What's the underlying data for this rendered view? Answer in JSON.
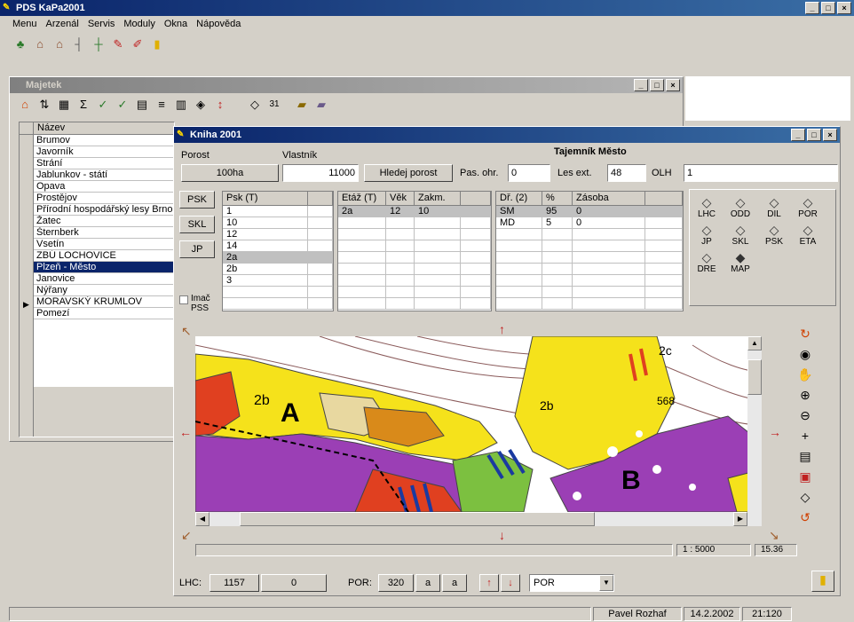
{
  "app": {
    "title": "PDS KaPa2001",
    "icon": "pds-app-icon"
  },
  "menu": [
    "Menu",
    "Arzenál",
    "Servis",
    "Moduly",
    "Okna",
    "Nápověda"
  ],
  "toolbar_icons": [
    "tree-icon",
    "building-icon",
    "buildings-icon",
    "ruler-icon",
    "ruler-add-icon",
    "paint-icon",
    "paint-red-icon",
    "exit-door-icon"
  ],
  "mdi": {
    "title": "Majetek",
    "toolbar_icons": [
      "home-icon",
      "sort-icon",
      "table-icon",
      "sum-icon",
      "check-icon",
      "check2-icon",
      "grid-icon",
      "filter-icon",
      "grid2-icon",
      "map-icon",
      "pin-icon",
      "layers-icon",
      "zoom-icon",
      "books-icon",
      "books2-icon"
    ],
    "zoom_value": "31"
  },
  "left_list": {
    "header": "Název",
    "items": [
      "Brumov",
      "Javorník",
      "Strání",
      "Jablunkov - státí",
      "Opava",
      "Prostějov",
      "Přírodní hospodářský lesy Brno",
      "Žatec",
      "Šternberk",
      "Vsetín",
      "ZBÚ LOCHOVICE",
      "Plzeň - Město",
      "Janovice",
      "Nýřany",
      "MORAVSKÝ KRUMLOV",
      "Pomezí"
    ],
    "selected_index": 11
  },
  "kniha": {
    "title": "Kniha 2001",
    "labels": {
      "porost": "Porost",
      "vlastnik": "Vlastník",
      "tajemnik": "Tajemník Město",
      "pas_ohr": "Pas. ohr.",
      "les_ext": "Les ext.",
      "olh": "OLH"
    },
    "fields": {
      "area": "100ha",
      "value": "11000",
      "pas_ohr": "0",
      "les_ext": "48",
      "olh": "1"
    },
    "hledej_button": "Hledej porost",
    "side_buttons": [
      "PSK",
      "SKL",
      "JP"
    ],
    "checkbox_label": "Imač PSS",
    "grid1": {
      "headers": [
        "Psk (T)",
        ""
      ],
      "rows": [
        [
          "1",
          ""
        ],
        [
          "10",
          ""
        ],
        [
          "12",
          ""
        ],
        [
          "14",
          ""
        ],
        [
          "2a",
          ""
        ],
        [
          "2b",
          ""
        ],
        [
          "3",
          ""
        ]
      ],
      "selected_index": 4
    },
    "grid2": {
      "headers": [
        "Etáž (T)",
        "Věk",
        "Zakm.",
        ""
      ],
      "rows": [
        [
          "2a",
          "12",
          "10",
          ""
        ]
      ],
      "selected_index": 0
    },
    "grid3": {
      "headers": [
        "Dř. (2)",
        "%",
        "Zásoba",
        ""
      ],
      "rows": [
        [
          "SM",
          "95",
          "0",
          ""
        ],
        [
          "MD",
          "5",
          "0",
          ""
        ]
      ],
      "selected_index": 0
    },
    "layers": [
      {
        "label": "LHC",
        "icon": "layer-lhc-icon"
      },
      {
        "label": "ODD",
        "icon": "layer-odd-icon"
      },
      {
        "label": "DIL",
        "icon": "layer-dil-icon"
      },
      {
        "label": "POR",
        "icon": "layer-por-icon"
      },
      {
        "label": "JP",
        "icon": "layer-jp-icon"
      },
      {
        "label": "SKL",
        "icon": "layer-skl-icon"
      },
      {
        "label": "PSK",
        "icon": "layer-psk-icon"
      },
      {
        "label": "ETA",
        "icon": "layer-eta-icon"
      },
      {
        "label": "DRE",
        "icon": "layer-dre-icon"
      },
      {
        "label": "MAP",
        "icon": "layer-map-icon"
      }
    ],
    "map_labels": {
      "a": "A",
      "b": "B",
      "l2b": "2b",
      "l2b2": "2b",
      "l2c": "2c",
      "l568": "568"
    },
    "map_tools": [
      "rotate-icon",
      "globe-icon",
      "pan-icon",
      "zoom-in-icon",
      "zoom-out-icon",
      "crosshair-icon",
      "print-icon",
      "layers-red-icon",
      "eye-icon",
      "rotate2-icon"
    ],
    "scale": "1 : 5000",
    "coords": "15.36",
    "bottom": {
      "lhc_label": "LHC:",
      "lhc_value": "1157",
      "lhc_second": "0",
      "por_label": "POR:",
      "por_value": "320",
      "por_a": "a",
      "por_b": "a",
      "dropdown": "POR"
    }
  },
  "status": {
    "user": "Pavel Rozhaf",
    "date": "14.2.2002",
    "time": "21:120"
  },
  "colors": {
    "title_active": "#0a246a",
    "selected": "#0a246a",
    "map_yellow": "#f5e21b",
    "map_purple": "#9b3fb5",
    "map_orange": "#d98a1a"
  }
}
